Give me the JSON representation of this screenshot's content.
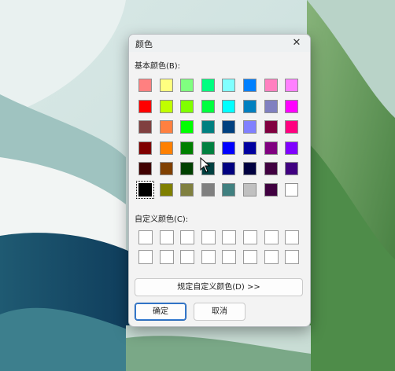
{
  "dialog": {
    "title": "颜色",
    "close_glyph": "✕",
    "basic_label": "基本颜色(B):",
    "custom_label": "自定义颜色(C):",
    "define_custom_label": "规定自定义颜色(D) >>",
    "ok_label": "确定",
    "cancel_label": "取消",
    "selected_basic_index": 40
  },
  "basic_colors": [
    "#ff8080",
    "#ffff80",
    "#80ff80",
    "#00ff80",
    "#80ffff",
    "#0080ff",
    "#ff80c0",
    "#ff80ff",
    "#ff0000",
    "#c0ff00",
    "#80ff00",
    "#00ff40",
    "#00ffff",
    "#0080c0",
    "#8080c0",
    "#ff00ff",
    "#804040",
    "#ff8040",
    "#00ff00",
    "#008080",
    "#004080",
    "#8080ff",
    "#800040",
    "#ff0080",
    "#800000",
    "#ff8000",
    "#008000",
    "#008040",
    "#0000ff",
    "#0000a0",
    "#800080",
    "#8000ff",
    "#400000",
    "#804000",
    "#004000",
    "#004040",
    "#000080",
    "#000040",
    "#400040",
    "#400080",
    "#000000",
    "#808000",
    "#808040",
    "#808080",
    "#408080",
    "#c0c0c0",
    "#400040",
    "#ffffff"
  ],
  "custom_colors": [
    "#ffffff",
    "#ffffff",
    "#ffffff",
    "#ffffff",
    "#ffffff",
    "#ffffff",
    "#ffffff",
    "#ffffff",
    "#ffffff",
    "#ffffff",
    "#ffffff",
    "#ffffff",
    "#ffffff",
    "#ffffff",
    "#ffffff",
    "#ffffff"
  ]
}
